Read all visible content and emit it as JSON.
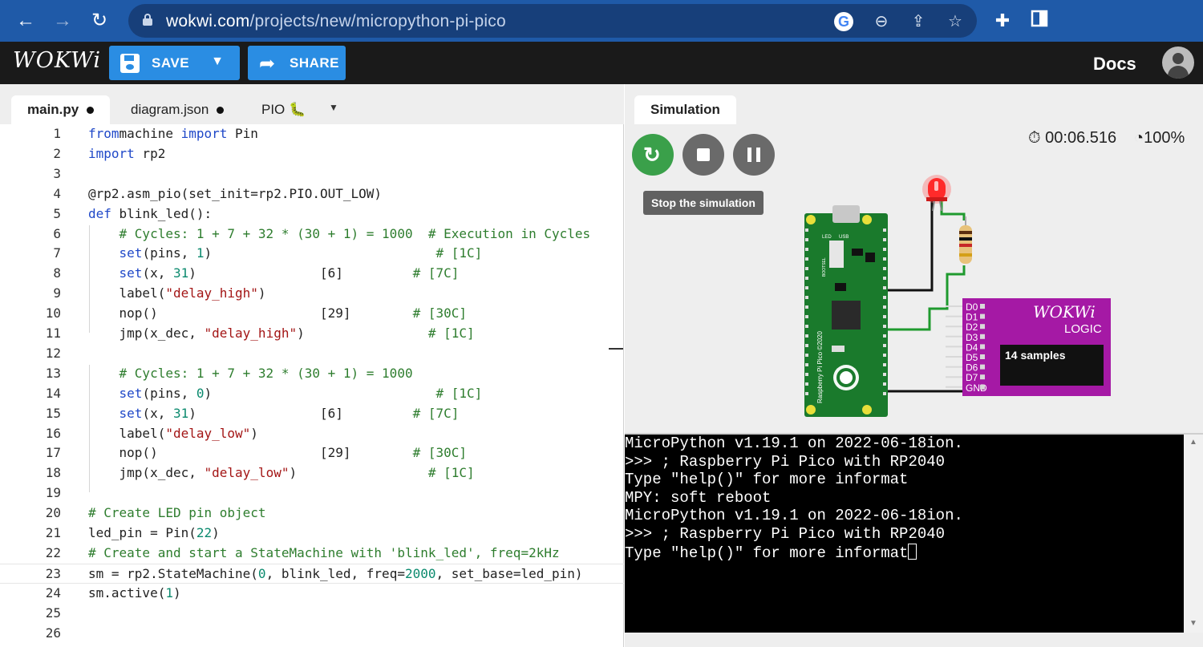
{
  "browser": {
    "url_host": "wokwi.com",
    "url_path": "/projects/new/micropython-pi-pico",
    "icons": [
      "back-arrow-icon",
      "forward-arrow-icon",
      "reload-icon",
      "lock-icon",
      "google-icon",
      "zoom-out-icon",
      "share-icon",
      "star-icon",
      "extensions-icon",
      "sidepanel-icon"
    ]
  },
  "header": {
    "logo": "WOKWi",
    "save_label": "SAVE",
    "share_label": "SHARE",
    "docs_label": "Docs",
    "accent_color": "#2a8de3"
  },
  "editor": {
    "tabs": [
      {
        "label": "main.py",
        "active": true,
        "modified": true
      },
      {
        "label": "diagram.json",
        "active": false,
        "modified": true
      },
      {
        "label": "PIO 🐛",
        "active": false,
        "modified": false
      }
    ],
    "current_line": 23,
    "lines": [
      [
        [
          "kw",
          "from"
        ],
        [
          "",
          "machine "
        ],
        [
          "kw",
          "import"
        ],
        [
          "",
          " Pin"
        ]
      ],
      [
        [
          "kw",
          "import"
        ],
        [
          "",
          " rp2"
        ]
      ],
      [],
      [
        [
          "",
          "@rp2.asm_pio(set_init=rp2.PIO.OUT_LOW)"
        ]
      ],
      [
        [
          "kw",
          "def"
        ],
        [
          "",
          " blink_led():"
        ]
      ],
      [
        [
          "cm",
          "    # Cycles: 1 + 7 + 32 * (30 + 1) = 1000  # Execution in Cycles"
        ]
      ],
      [
        [
          "",
          "    "
        ],
        [
          "kw",
          "set"
        ],
        [
          "",
          "(pins, "
        ],
        [
          "num",
          "1"
        ],
        [
          "",
          ")                             "
        ],
        [
          "cm",
          "# [1C]"
        ]
      ],
      [
        [
          "",
          "    "
        ],
        [
          "kw",
          "set"
        ],
        [
          "",
          "(x, "
        ],
        [
          "num",
          "31"
        ],
        [
          "",
          ")                [6]         "
        ],
        [
          "cm",
          "# [7C]"
        ]
      ],
      [
        [
          "",
          "    label("
        ],
        [
          "str",
          "\"delay_high\""
        ],
        [
          "",
          ")"
        ]
      ],
      [
        [
          "",
          "    nop()                     [29]        "
        ],
        [
          "cm",
          "# [30C]"
        ]
      ],
      [
        [
          "",
          "    jmp(x_dec, "
        ],
        [
          "str",
          "\"delay_high\""
        ],
        [
          "",
          ")                "
        ],
        [
          "cm",
          "# [1C]"
        ]
      ],
      [],
      [
        [
          "cm",
          "    # Cycles: 1 + 7 + 32 * (30 + 1) = 1000"
        ]
      ],
      [
        [
          "",
          "    "
        ],
        [
          "kw",
          "set"
        ],
        [
          "",
          "(pins, "
        ],
        [
          "num",
          "0"
        ],
        [
          "",
          ")                             "
        ],
        [
          "cm",
          "# [1C]"
        ]
      ],
      [
        [
          "",
          "    "
        ],
        [
          "kw",
          "set"
        ],
        [
          "",
          "(x, "
        ],
        [
          "num",
          "31"
        ],
        [
          "",
          ")                [6]         "
        ],
        [
          "cm",
          "# [7C]"
        ]
      ],
      [
        [
          "",
          "    label("
        ],
        [
          "str",
          "\"delay_low\""
        ],
        [
          "",
          ")"
        ]
      ],
      [
        [
          "",
          "    nop()                     [29]        "
        ],
        [
          "cm",
          "# [30C]"
        ]
      ],
      [
        [
          "",
          "    jmp(x_dec, "
        ],
        [
          "str",
          "\"delay_low\""
        ],
        [
          "",
          ")                 "
        ],
        [
          "cm",
          "# [1C]"
        ]
      ],
      [],
      [
        [
          "cm",
          "# Create LED pin object"
        ]
      ],
      [
        [
          "",
          "led_pin = Pin("
        ],
        [
          "num",
          "22"
        ],
        [
          "",
          ")"
        ]
      ],
      [
        [
          "cm",
          "# Create and start a StateMachine with 'blink_led', freq=2kHz"
        ]
      ],
      [
        [
          "",
          "sm = rp2.StateMachine("
        ],
        [
          "num",
          "0"
        ],
        [
          "",
          ", blink_led, freq="
        ],
        [
          "num",
          "2000"
        ],
        [
          "",
          ", set_base=led_pin)"
        ]
      ],
      [
        [
          "",
          "sm.active("
        ],
        [
          "num",
          "1"
        ],
        [
          "",
          ")"
        ]
      ],
      [],
      []
    ]
  },
  "simulation": {
    "tab_label": "Simulation",
    "tooltip": "Stop the simulation",
    "timer": "00:06.516",
    "speed": "100%",
    "buttons": [
      "restart",
      "stop",
      "pause"
    ],
    "logic_analyzer": {
      "brand": "WOKWi",
      "title": "LOGIC",
      "samples": "14 samples",
      "pins": [
        "D0",
        "D1",
        "D2",
        "D3",
        "D4",
        "D5",
        "D6",
        "D7",
        "GND"
      ]
    },
    "board": {
      "silk_text": "Raspberry Pi Pico ©2020",
      "led_label": "LED",
      "usb_label": "USB",
      "bootsel_label": "BOOTSEL"
    }
  },
  "serial_monitor": {
    "lines": [
      "MicroPython v1.19.1 on 2022-06-18ion.",
      ">>> ; Raspberry Pi Pico with RP2040",
      "Type \"help()\" for more informat",
      "MPY: soft reboot",
      "MicroPython v1.19.1 on 2022-06-18ion.",
      ">>> ; Raspberry Pi Pico with RP2040",
      "Type \"help()\" for more informat"
    ]
  }
}
